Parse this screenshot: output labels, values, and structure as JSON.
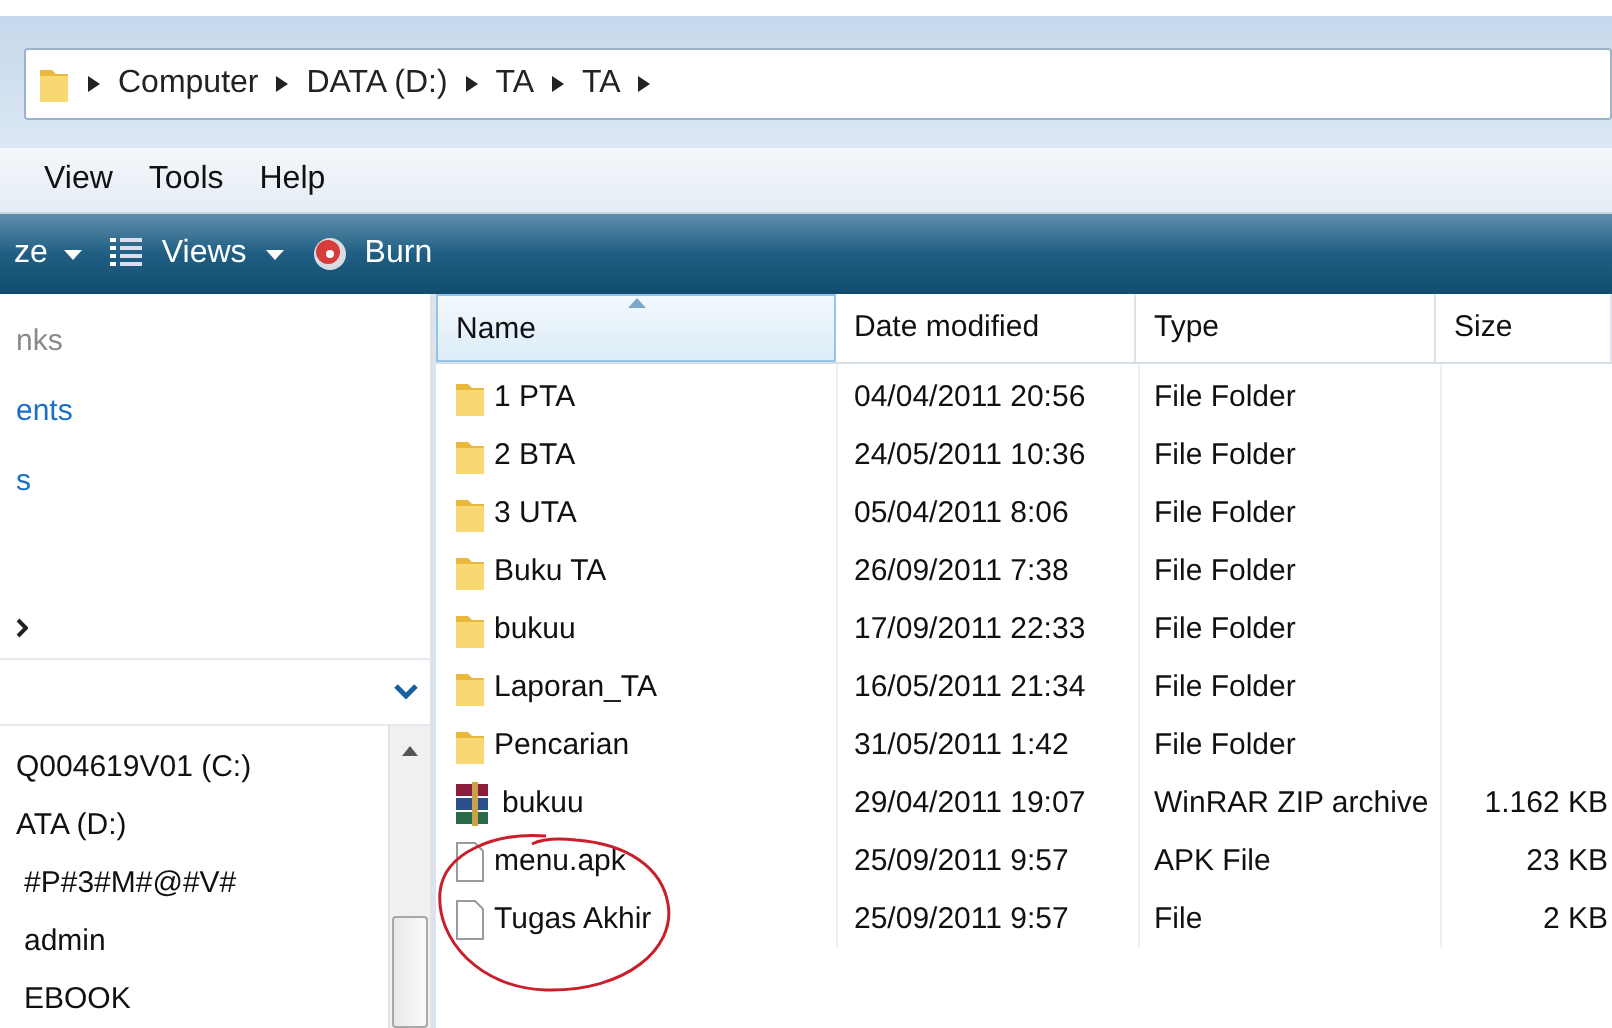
{
  "address_bar": {
    "crumbs": [
      "Computer",
      "DATA (D:)",
      "TA",
      "TA"
    ]
  },
  "menu_bar": [
    "View",
    "Tools",
    "Help"
  ],
  "toolbar": [
    {
      "label": "ze",
      "kind": "dropdown"
    },
    {
      "label": "Views",
      "kind": "views"
    },
    {
      "label": "Burn",
      "kind": "burn"
    }
  ],
  "sidebar": {
    "links": [
      {
        "label": "nks",
        "kind": "heading"
      },
      {
        "label": "ents",
        "kind": "link"
      },
      {
        "label": "s",
        "kind": "link"
      }
    ],
    "tree": [
      {
        "label": "Q004619V01 (C:)"
      },
      {
        "label": "ATA (D:)",
        "children": [
          {
            "label": "#P#3#M#@#V#"
          },
          {
            "label": "admin"
          },
          {
            "label": "EBOOK"
          }
        ]
      }
    ]
  },
  "file_list": {
    "columns": [
      "Name",
      "Date modified",
      "Type",
      "Size"
    ],
    "rows": [
      {
        "kind": "folder",
        "name": "1 PTA",
        "date": "04/04/2011 20:56",
        "type": "File Folder"
      },
      {
        "kind": "folder",
        "name": "2 BTA",
        "date": "24/05/2011 10:36",
        "type": "File Folder"
      },
      {
        "kind": "folder",
        "name": "3 UTA",
        "date": "05/04/2011 8:06",
        "type": "File Folder"
      },
      {
        "kind": "folder",
        "name": "Buku TA",
        "date": "26/09/2011 7:38",
        "type": "File Folder"
      },
      {
        "kind": "folder",
        "name": "bukuu",
        "date": "17/09/2011 22:33",
        "type": "File Folder"
      },
      {
        "kind": "folder",
        "name": "Laporan_TA",
        "date": "16/05/2011 21:34",
        "type": "File Folder"
      },
      {
        "kind": "folder",
        "name": "Pencarian",
        "date": "31/05/2011 1:42",
        "type": "File Folder"
      },
      {
        "kind": "archive",
        "name": "bukuu",
        "date": "29/04/2011 19:07",
        "type": "WinRAR ZIP archive",
        "size": "1.162 KB"
      },
      {
        "kind": "file",
        "name": "menu.apk",
        "date": "25/09/2011 9:57",
        "type": "APK File",
        "size": "23 KB"
      },
      {
        "kind": "file",
        "name": "Tugas Akhir",
        "date": "25/09/2011 9:57",
        "type": "File",
        "size": "2 KB"
      }
    ]
  }
}
